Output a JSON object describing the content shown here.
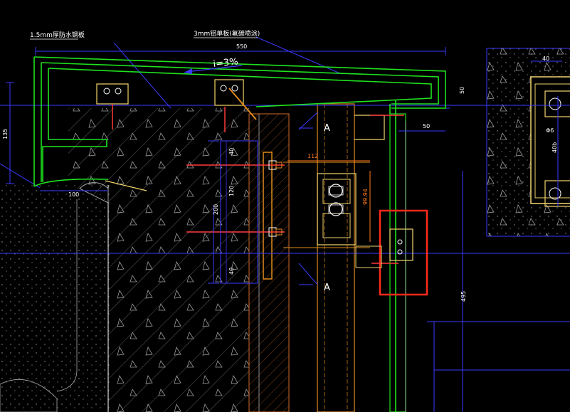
{
  "labels": {
    "waterproof_plate": "1.5mm厚防水钢板",
    "aluminum_panel": "3mm铝单板(氟碳喷涂)",
    "slope": "i=3%",
    "section_a_top": "A",
    "section_a_bottom": "A"
  },
  "dimensions": {
    "d550": "550",
    "d50_right": "50",
    "d50_bottom": "50",
    "d135": "135",
    "d100": "100",
    "d112": "112",
    "d99_94": "99.94",
    "d40_top": "40",
    "d120": "120",
    "d40_bottom": "40",
    "d200": "200",
    "d495": "495",
    "d40_detail": "40",
    "d16_detail": "Φ6",
    "d40b_detail": "40b"
  },
  "colors": {
    "background": "#000000",
    "panel_green": "#1ee31e",
    "dimension_blue": "#3a3aff",
    "concrete_grey": "#8a8a8a",
    "steel_orange": "#e08a1e",
    "anchor_red": "#ff3a3a",
    "highlight_red": "#ff2a1a",
    "detail_yellow": "#f2d46a"
  }
}
